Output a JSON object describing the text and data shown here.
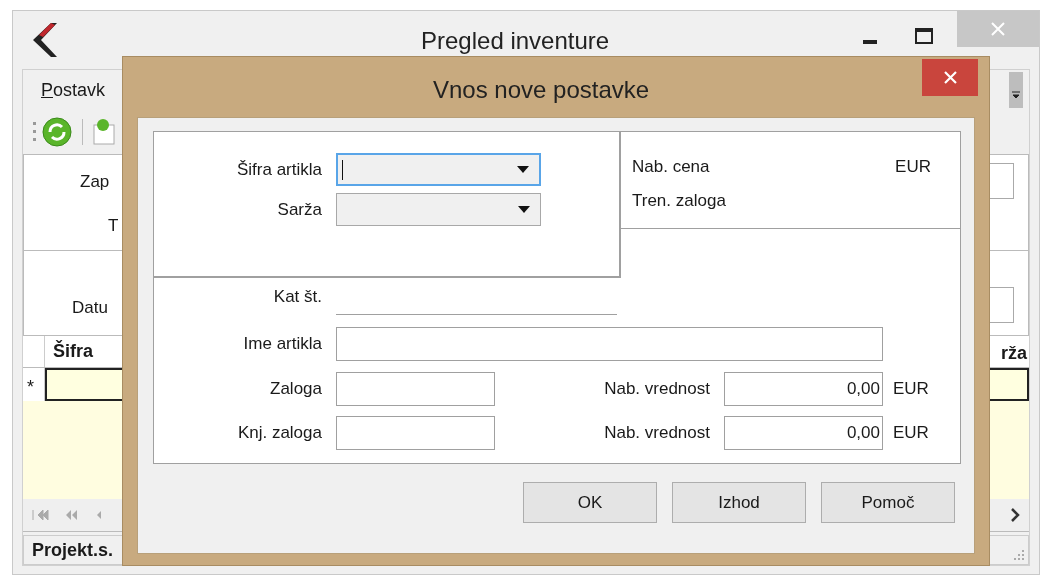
{
  "window": {
    "title": "Pregled inventure"
  },
  "menu": [
    {
      "label": "Postavk"
    }
  ],
  "form_labels": [
    "Zap",
    "T",
    "Datu"
  ],
  "grid": {
    "columns": [
      "Šifra",
      "rža"
    ],
    "new_row_marker": "*"
  },
  "status_bar": {
    "text": "Projekt.s."
  },
  "dialog": {
    "title": "Vnos nove postavke",
    "combos": [
      {
        "label": "Šifra artikla",
        "focused": true
      },
      {
        "label": "Sarža",
        "focused": false
      }
    ],
    "info": [
      {
        "label": "Nab. cena",
        "unit": "EUR"
      },
      {
        "label": "Tren. zaloga"
      }
    ],
    "catalog_number": {
      "label": "Kat št."
    },
    "item_name": {
      "label": "Ime artikla"
    },
    "rows": [
      {
        "label": "Zaloga",
        "value_label": "Nab. vrednost",
        "value": "0,00",
        "unit": "EUR"
      },
      {
        "label": "Knj. zaloga",
        "value_label": "Nab. vrednost",
        "value": "0,00",
        "unit": "EUR"
      }
    ],
    "buttons": [
      "OK",
      "Izhod",
      "Pomoč"
    ]
  }
}
